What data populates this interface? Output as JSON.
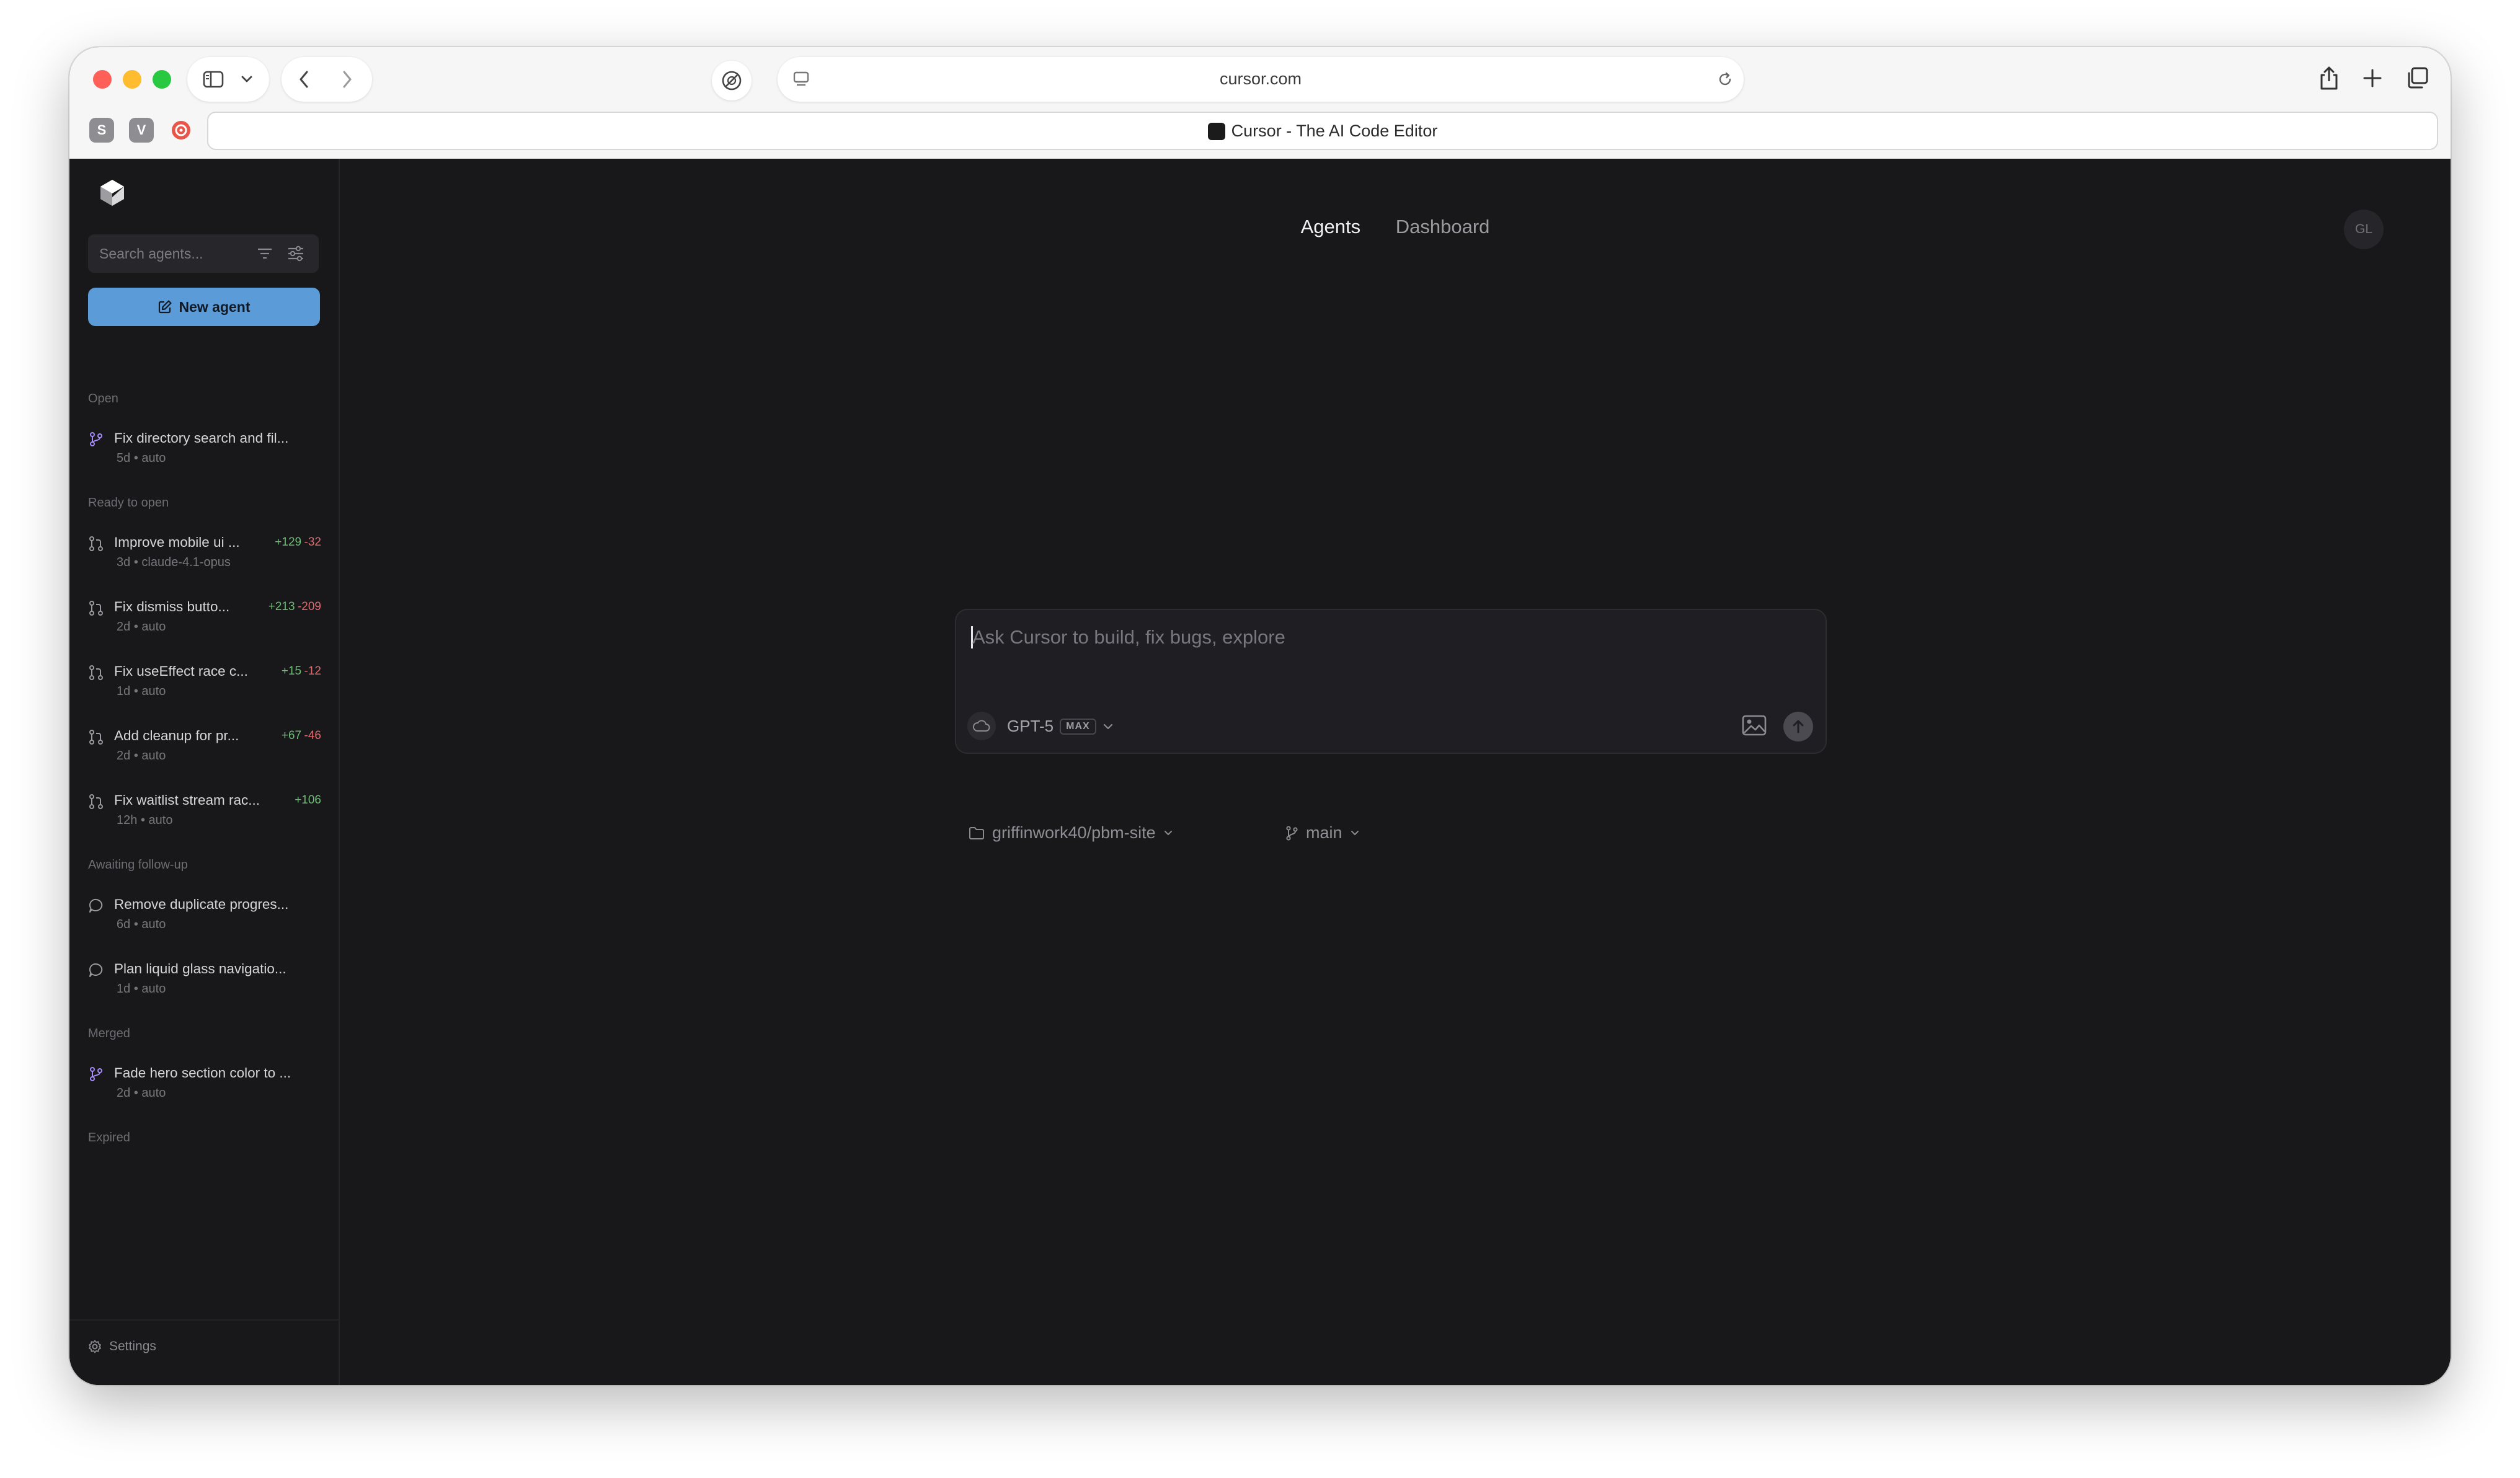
{
  "browser": {
    "url": "cursor.com",
    "tab_title": "Cursor - The AI Code Editor",
    "pinned_tabs": [
      {
        "letter": "S",
        "color": "#8d8d92"
      },
      {
        "letter": "V",
        "color": "#8d8d92"
      },
      {
        "letter": "",
        "color": "#e8564a"
      }
    ]
  },
  "sidebar": {
    "search_placeholder": "Search agents...",
    "new_agent_label": "New agent",
    "sections": {
      "open": "Open",
      "ready": "Ready to open",
      "awaiting": "Awaiting follow-up",
      "merged": "Merged",
      "expired": "Expired"
    },
    "open_items": [
      {
        "title": "Fix directory search and fil...",
        "age": "5d",
        "model": "auto"
      }
    ],
    "ready_items": [
      {
        "title": "Improve mobile ui ...",
        "age": "3d",
        "model": "claude-4.1-opus",
        "added": "+129",
        "removed": "-32"
      },
      {
        "title": "Fix dismiss butto...",
        "age": "2d",
        "model": "auto",
        "added": "+213",
        "removed": "-209"
      },
      {
        "title": "Fix useEffect race c...",
        "age": "1d",
        "model": "auto",
        "added": "+15",
        "removed": "-12"
      },
      {
        "title": "Add cleanup for pr...",
        "age": "2d",
        "model": "auto",
        "added": "+67",
        "removed": "-46"
      },
      {
        "title": "Fix waitlist stream rac...",
        "age": "12h",
        "model": "auto",
        "added": "+106",
        "removed": ""
      }
    ],
    "awaiting_items": [
      {
        "title": "Remove duplicate progres...",
        "age": "6d",
        "model": "auto"
      },
      {
        "title": "Plan liquid glass navigatio...",
        "age": "1d",
        "model": "auto"
      }
    ],
    "merged_items": [
      {
        "title": "Fade hero section color to ...",
        "age": "2d",
        "model": "auto"
      }
    ],
    "separator": "•",
    "settings_label": "Settings"
  },
  "main": {
    "nav": {
      "agents": "Agents",
      "dashboard": "Dashboard"
    },
    "avatar_initials": "GL",
    "composer": {
      "placeholder": "Ask Cursor to build, fix bugs, explore",
      "model": "GPT-5",
      "max_badge": "MAX"
    },
    "repo": "griffinwork40/pbm-site",
    "branch": "main"
  },
  "colors": {
    "background": "#18181b",
    "accent": "#5b9bd8",
    "added": "#6bbf73",
    "removed": "#e0696c"
  }
}
